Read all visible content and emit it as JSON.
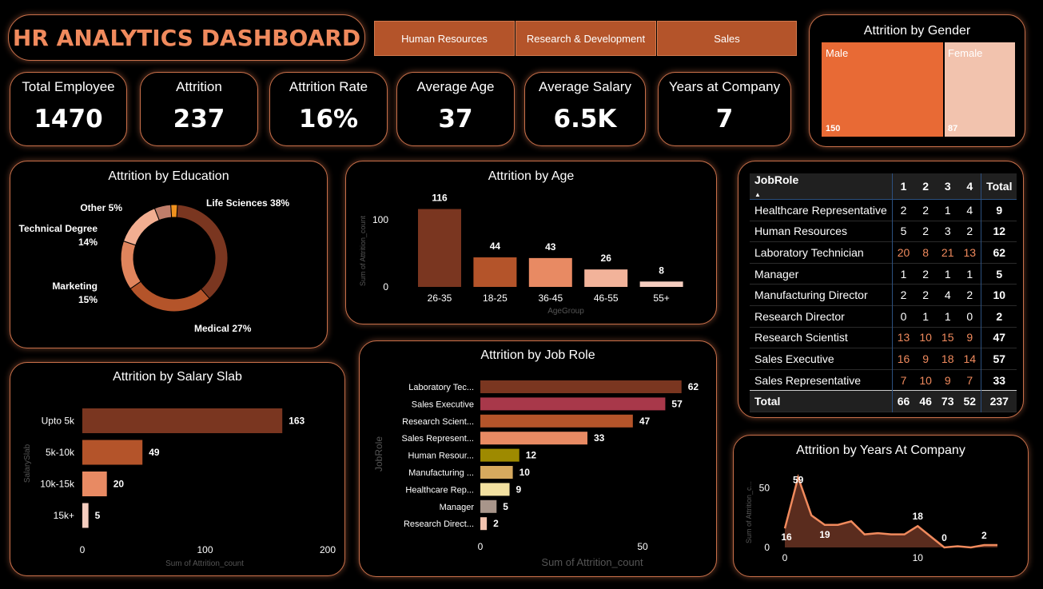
{
  "title": "HR ANALYTICS DASHBOARD",
  "tabs": [
    "Human Resources",
    "Research & Development",
    "Sales"
  ],
  "kpis": [
    {
      "label": "Total Employee",
      "value": "1470"
    },
    {
      "label": "Attrition",
      "value": "237"
    },
    {
      "label": "Attrition Rate",
      "value": "16%"
    },
    {
      "label": "Average Age",
      "value": "37"
    },
    {
      "label": "Average Salary",
      "value": "6.5K"
    },
    {
      "label": "Years at Company",
      "value": "7"
    }
  ],
  "colors": {
    "accent": "#c9704a",
    "title": "#f08a5d",
    "tab": "#b4542a",
    "male": "#e86a35",
    "female": "#f2c3ae"
  },
  "gender": {
    "title": "Attrition by Gender",
    "items": [
      {
        "name": "Male",
        "value": 150,
        "label": "150",
        "color": "#e86a35"
      },
      {
        "name": "Female",
        "value": 87,
        "label": "87",
        "color": "#f2c3ae"
      }
    ]
  },
  "charts": {
    "education": {
      "type": "pie",
      "title": "Attrition by Education",
      "slices": [
        {
          "name": "Life Sciences 38%",
          "value": 38,
          "color": "#7a3620"
        },
        {
          "name": "Medical 27%",
          "value": 27,
          "color": "#b4542a"
        },
        {
          "name": "Marketing 15%",
          "value": 15,
          "color": "#e0845c"
        },
        {
          "name": "Technical Degree 14%",
          "value": 14,
          "color": "#f2ae91"
        },
        {
          "name": "Other 5%",
          "value": 5,
          "color": "#c07e6a"
        },
        {
          "name": "",
          "value": 2,
          "color": "#f0921e"
        }
      ],
      "labels": [
        {
          "lines": [
            "Life Sciences 38%"
          ]
        },
        {
          "lines": [
            "Medical 27%"
          ]
        },
        {
          "lines": [
            "Marketing",
            "15%"
          ]
        },
        {
          "lines": [
            "Technical Degree",
            "14%"
          ]
        },
        {
          "lines": [
            "Other 5%"
          ]
        }
      ]
    },
    "age": {
      "type": "bar",
      "title": "Attrition by Age",
      "categories": [
        "26-35",
        "18-25",
        "36-45",
        "46-55",
        "55+"
      ],
      "values": [
        116,
        44,
        43,
        26,
        8
      ],
      "colors": [
        "#7a3620",
        "#b4542a",
        "#e88a63",
        "#f2b39a",
        "#f5cdbf"
      ],
      "xlabel": "AgeGroup",
      "ylabel": "Sum of Attrition_count",
      "yticks": [
        0,
        100
      ],
      "ylim": [
        0,
        125
      ]
    },
    "salary": {
      "type": "bar",
      "title": "Attrition by Salary Slab",
      "categories": [
        "Upto 5k",
        "5k-10k",
        "10k-15k",
        "15k+"
      ],
      "values": [
        163,
        49,
        20,
        5
      ],
      "colors": [
        "#7a3620",
        "#b4542a",
        "#e88a63",
        "#f5cdbf"
      ],
      "xlabel": "Sum of Attrition_count",
      "ylabel": "SalarySlab",
      "xticks": [
        0,
        100,
        200
      ],
      "xlim": [
        0,
        200
      ]
    },
    "jobrole": {
      "type": "bar",
      "title": "Attrition by Job Role",
      "categories": [
        "Laboratory Tec...",
        "Sales Executive",
        "Research Scient...",
        "Sales Represent...",
        "Human Resour...",
        "Manufacturing ...",
        "Healthcare Rep...",
        "Manager",
        "Research Direct..."
      ],
      "values": [
        62,
        57,
        47,
        33,
        12,
        10,
        9,
        5,
        2
      ],
      "colors": [
        "#7a3620",
        "#a8384a",
        "#b4542a",
        "#e88a63",
        "#9e8a00",
        "#d6a95e",
        "#f2e0a0",
        "#a8958a",
        "#f2c3ae"
      ],
      "xlabel": "Sum of Attrition_count",
      "ylabel": "JobRole",
      "xticks": [
        0,
        50
      ],
      "xlim": [
        0,
        65
      ]
    },
    "years": {
      "type": "area",
      "title": "Attrition by Years At Company",
      "x": [
        0,
        1,
        2,
        3,
        4,
        5,
        6,
        7,
        8,
        9,
        10,
        11,
        12,
        13,
        14,
        15,
        16
      ],
      "y": [
        16,
        59,
        27,
        19,
        19,
        22,
        11,
        12,
        11,
        11,
        18,
        9,
        0,
        1,
        0,
        2,
        2
      ],
      "xlabel": "",
      "ylabel": "Sum of Attrition_c...",
      "xticks": [
        0,
        10
      ],
      "yticks": [
        0,
        50
      ],
      "ylim": [
        0,
        65
      ],
      "xlim": [
        0,
        16
      ],
      "data_labels": [
        {
          "i": 0,
          "text": "16"
        },
        {
          "i": 1,
          "text": "59"
        },
        {
          "i": 3,
          "text": "19"
        },
        {
          "i": 10,
          "text": "18"
        },
        {
          "i": 12,
          "text": "0"
        },
        {
          "i": 15,
          "text": "2"
        }
      ]
    }
  },
  "matrix": {
    "headers": [
      "JobRole",
      "1",
      "2",
      "3",
      "4",
      "Total"
    ],
    "rows": [
      {
        "role": "Healthcare Representative",
        "vals": [
          "2",
          "2",
          "1",
          "4"
        ],
        "total": "9",
        "hl": false
      },
      {
        "role": "Human Resources",
        "vals": [
          "5",
          "2",
          "3",
          "2"
        ],
        "total": "12",
        "hl": false
      },
      {
        "role": "Laboratory Technician",
        "vals": [
          "20",
          "8",
          "21",
          "13"
        ],
        "total": "62",
        "hl": true
      },
      {
        "role": "Manager",
        "vals": [
          "1",
          "2",
          "1",
          "1"
        ],
        "total": "5",
        "hl": false
      },
      {
        "role": "Manufacturing Director",
        "vals": [
          "2",
          "2",
          "4",
          "2"
        ],
        "total": "10",
        "hl": false
      },
      {
        "role": "Research Director",
        "vals": [
          "0",
          "1",
          "1",
          "0"
        ],
        "total": "2",
        "hl": false
      },
      {
        "role": "Research Scientist",
        "vals": [
          "13",
          "10",
          "15",
          "9"
        ],
        "total": "47",
        "hl": true
      },
      {
        "role": "Sales Executive",
        "vals": [
          "16",
          "9",
          "18",
          "14"
        ],
        "total": "57",
        "hl": true
      },
      {
        "role": "Sales Representative",
        "vals": [
          "7",
          "10",
          "9",
          "7"
        ],
        "total": "33",
        "hl": true
      }
    ],
    "total": {
      "label": "Total",
      "vals": [
        "66",
        "46",
        "73",
        "52"
      ],
      "total": "237"
    }
  }
}
